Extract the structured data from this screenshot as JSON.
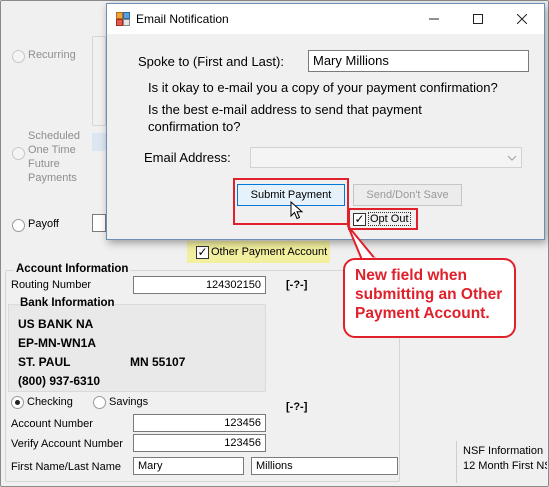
{
  "background": {
    "recurring_label": "Recurring",
    "scheduled_label": "Scheduled One Time Future Payments",
    "payoff_label": "Payoff",
    "other_payment_label": "Other Payment Account",
    "account_info_heading": "Account Information",
    "routing_label": "Routing Number",
    "routing_value": "124302150",
    "routing_help": "[-?-]",
    "bank_info_heading": "Bank Information",
    "bank_name": "US BANK NA",
    "bank_code": "EP-MN-WN1A",
    "bank_city": "ST. PAUL",
    "bank_state_zip": "MN 55107",
    "bank_phone": "(800) 937-6310",
    "checking_label": "Checking",
    "savings_label": "Savings",
    "account_help": "[-?-]",
    "account_number_label": "Account Number",
    "account_number_value": "123456",
    "verify_account_label": "Verify Account Number",
    "verify_account_value": "123456",
    "name_label": "First Name/Last Name",
    "first_name": "Mary",
    "last_name": "Millions",
    "nsf_line1": "NSF Information",
    "nsf_line2": "12 Month First NS"
  },
  "dialog": {
    "title": "Email Notification",
    "spoke_to_label": "Spoke to (First and Last):",
    "spoke_to_value": "Mary Millions",
    "question1": "Is it okay to e-mail you a copy of your payment confirmation?",
    "question2": "Is  the best e-mail address to send that payment confirmation to?",
    "email_label": "Email Address:",
    "email_value": "",
    "submit_label": "Submit Payment",
    "send_label": "Send/Don't Save",
    "opt_out_label": "Opt Out"
  },
  "callout": {
    "text": "New field when submitting an Other Payment Account."
  },
  "colors": {
    "annotation_red": "#e0202a",
    "highlight_yellow": "#f2ef9e",
    "button_blue": "#0078d7"
  }
}
